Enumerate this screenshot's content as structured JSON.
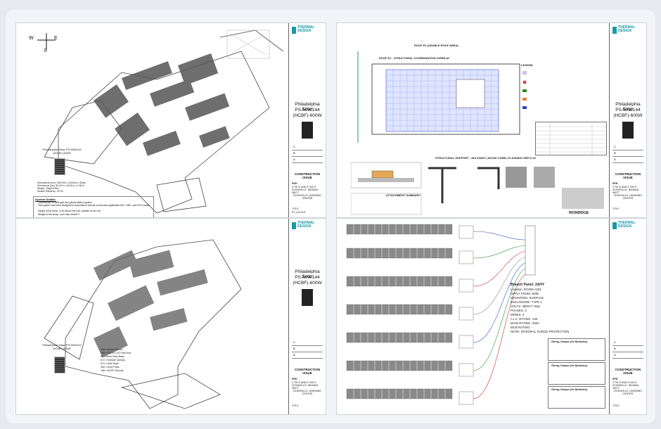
{
  "title_block": {
    "logo_text": "THERMAL DESIGN",
    "project_line1": "Philadelphia Solar",
    "project_line2": "PS-MN0144",
    "project_line3": "(HCBF)-600W",
    "construction_issue": "CONSTRUCTION ISSUE",
    "rev_letters": [
      "C",
      "B",
      "A"
    ],
    "rfi": "RFE:",
    "address": "3 TIE-E AND E 330 S ZIONSVILLE, INDIANA 46077",
    "school": "ZIONSVILLE LEARNING CENTER",
    "title_label": "TITLE",
    "sheet_title_tl": "PV LAYOUT"
  },
  "sheets": {
    "top_left": {
      "compass": {
        "w": "W",
        "e": "E",
        "s": "S"
      },
      "panel_caption": "Philadelphia Solar PS-MN0144 (HCBF)-600W",
      "dimensions": "Dimensions (mm): 2357mm x 1133mm x 35mm\nDimensions (ins): 89.44 in x 44.60 in x 1.38 in\nWeight: 29kg/63.9lbs\nModule Efficiency: 23.2%",
      "system_details_title": "System Details:",
      "system_details": [
        "Commercial 99.6kW grid tied (photovoltaic) system",
        "This system has been designed in accordance with all current and applicable NEC, OBC, and RCO codes",
        "Height of the Array: 3-4in above the roof, parallel to the roof",
        "Weight of the Array: Less than 4lbs/ft^2"
      ]
    },
    "top_right": {
      "header": "ROOF E1 (USABLE ROOF AREA)",
      "subheader": "ROOF E1 - STRUCTURAL COORDINATION OVERLAY",
      "legend_title": "LEGEND",
      "structural_title": "STRUCTURAL SUPPORT - ADI 4/5/3/2 | WOOD CURB | FLASHING SEE D-02",
      "attachment": "ATTACHMENT SUMMARY",
      "ironridge": "IRONRIDGE"
    },
    "bottom_left": {
      "panel_caption": "Philadelphia Solar PS-MN0144 (HCBF)-600W",
      "counts": "168 x Bolted Blocks\n188 x FM FLCO2 Field Box\n88 x North Row Base\n672 x Module Clamps\n672 x Side Bolts\n360 x Roof Pads\n188 x MLPE Mounts"
    },
    "bottom_right": {
      "panel_title": "Branch Panel: 2AHY",
      "location": "Location: ROOM A201",
      "supply": "SPPLY FROM: MSB",
      "mounting": "MOUNTING: SURFACE",
      "enclosure": "ENCLOSURE: TYPE 1",
      "volts": "VOLTS: 480/277 Wye",
      "phases": "PHASES: 3",
      "wires": "WIRES: 4",
      "aic": "A.I.C. RATING: 14K",
      "main": "MAIN RATING: 400A",
      "mcb": "MCB RATING: -",
      "note": "NOTE: INTEGRAL SURGE PROTECTION",
      "string_output": "String Output (3x Modules)"
    }
  }
}
